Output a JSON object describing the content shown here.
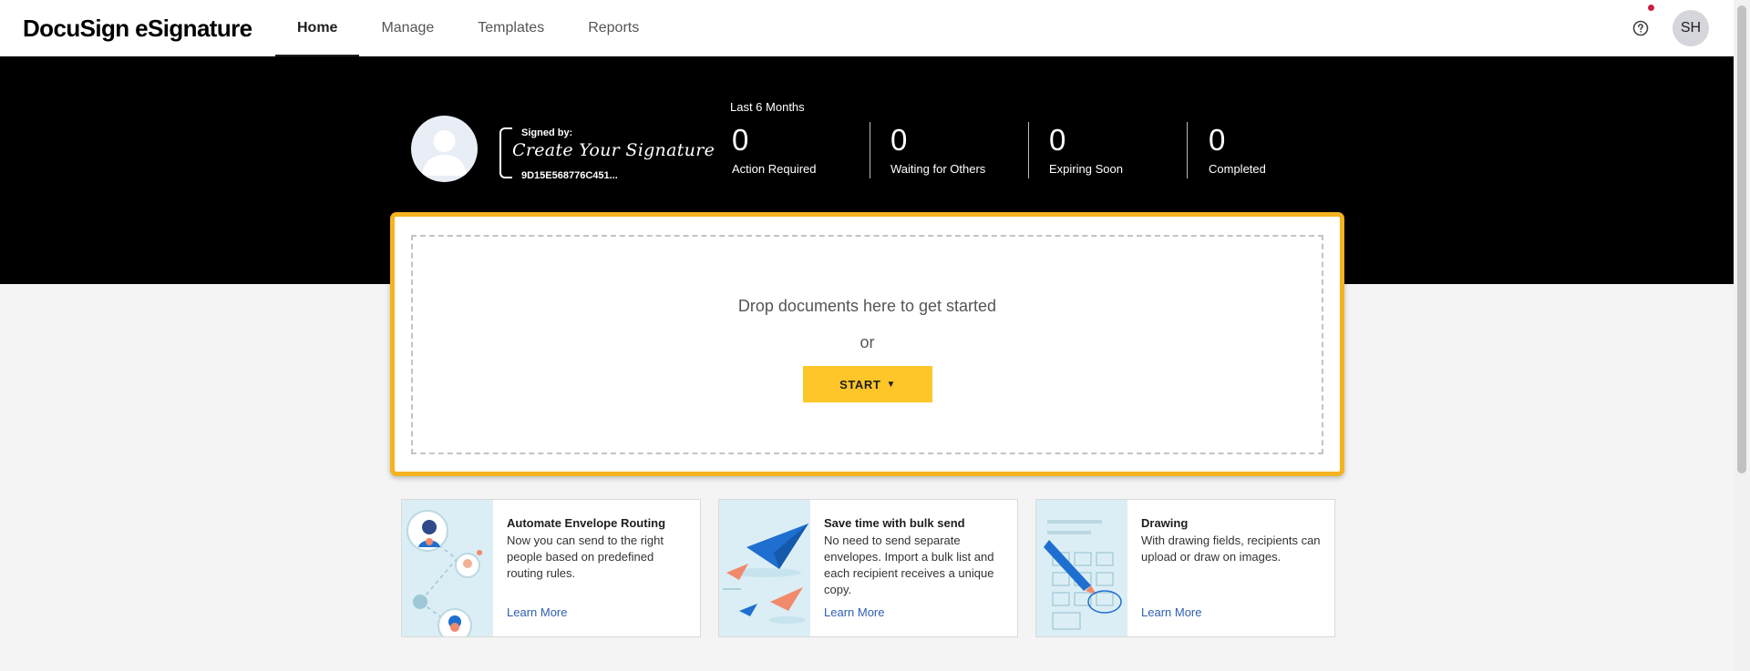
{
  "app": {
    "logo": "DocuSign eSignature",
    "nav": [
      {
        "label": "Home",
        "active": true
      },
      {
        "label": "Manage",
        "active": false
      },
      {
        "label": "Templates",
        "active": false
      },
      {
        "label": "Reports",
        "active": false
      }
    ],
    "help_icon": "help-circle-icon",
    "user_initials": "SH",
    "notification_color": "#cc1f4d"
  },
  "profile": {
    "signed_by": "Signed by:",
    "signature_placeholder": "Create Your Signature",
    "signature_id": "9D15E568776C451..."
  },
  "stats": {
    "period": "Last 6 Months",
    "items": [
      {
        "value": "0",
        "label": "Action Required"
      },
      {
        "value": "0",
        "label": "Waiting for Others"
      },
      {
        "value": "0",
        "label": "Expiring Soon"
      },
      {
        "value": "0",
        "label": "Completed"
      }
    ]
  },
  "dropzone": {
    "prompt": "Drop documents here to get started",
    "or": "or",
    "start_label": "START",
    "highlight_color": "#f5b320",
    "button_color": "#ffc629"
  },
  "cards": [
    {
      "title": "Automate Envelope Routing",
      "text": "Now you can send to the right people based on predefined routing rules.",
      "link": "Learn More",
      "art_icon": "routing-illustration-icon"
    },
    {
      "title": "Save time with bulk send",
      "text": "No need to send separate envelopes. Import a bulk list and each recipient receives a unique copy.",
      "link": "Learn More",
      "art_icon": "paper-planes-illustration-icon"
    },
    {
      "title": "Drawing",
      "text": "With drawing fields, recipients can upload or draw on images.",
      "link": "Learn More",
      "art_icon": "pen-drawing-illustration-icon"
    }
  ]
}
